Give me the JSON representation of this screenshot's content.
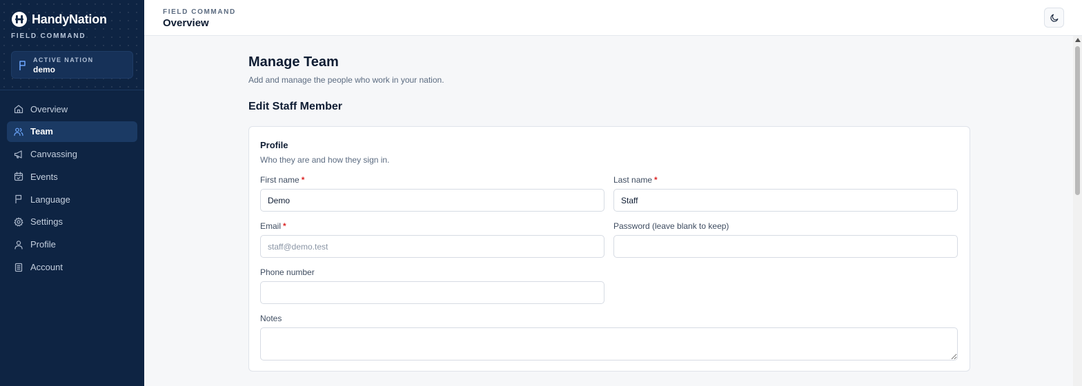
{
  "brand": {
    "name": "HandyNation",
    "subtitle": "FIELD COMMAND"
  },
  "nation": {
    "label": "ACTIVE NATION",
    "value": "demo"
  },
  "nav": {
    "items": [
      {
        "label": "Overview",
        "icon": "home-icon"
      },
      {
        "label": "Team",
        "icon": "users-icon",
        "active": true
      },
      {
        "label": "Canvassing",
        "icon": "megaphone-icon"
      },
      {
        "label": "Events",
        "icon": "calendar-icon"
      },
      {
        "label": "Language",
        "icon": "flag-icon"
      },
      {
        "label": "Settings",
        "icon": "gear-icon"
      },
      {
        "label": "Profile",
        "icon": "user-icon"
      },
      {
        "label": "Account",
        "icon": "building-icon"
      }
    ]
  },
  "header": {
    "kicker": "FIELD COMMAND",
    "title": "Overview",
    "theme_icon": "moon-icon"
  },
  "main": {
    "title": "Manage Team",
    "subtitle": "Add and manage the people who work in your nation.",
    "section_title": "Edit Staff Member"
  },
  "profile": {
    "title": "Profile",
    "subtitle": "Who they are and how they sign in.",
    "first_name": {
      "label": "First name",
      "required": "*",
      "value": "Demo"
    },
    "last_name": {
      "label": "Last name",
      "required": "*",
      "value": "Staff"
    },
    "email": {
      "label": "Email",
      "required": "*",
      "value": "",
      "placeholder": "staff@demo.test"
    },
    "password": {
      "label": "Password (leave blank to keep)",
      "value": ""
    },
    "phone": {
      "label": "Phone number",
      "value": ""
    },
    "notes": {
      "label": "Notes",
      "value": ""
    }
  },
  "colors": {
    "sidebar_bg": "#0e2443",
    "accent": "#3b82f6",
    "required": "#dc2626"
  }
}
